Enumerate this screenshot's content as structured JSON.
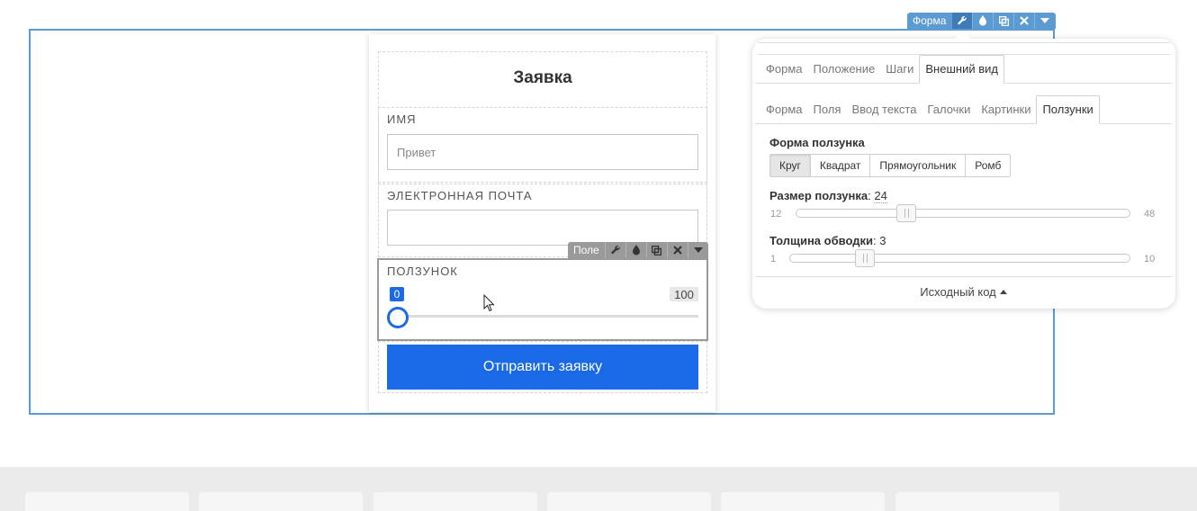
{
  "block_toolbar": {
    "label": "Форма",
    "icons": [
      "wrench-icon",
      "drop-icon",
      "copy-icon",
      "close-icon",
      "caret-down-icon"
    ]
  },
  "form": {
    "title": "Заявка",
    "fields": [
      {
        "label": "ИМЯ",
        "value": "Привет"
      },
      {
        "label": "ЭЛЕКТРОННАЯ ПОЧТА",
        "value": ""
      }
    ],
    "slider": {
      "label": "ПОЛЗУНОК",
      "min_badge": "0",
      "max_badge": "100",
      "value_fraction": 0.0
    },
    "submit_label": "Отправить заявку"
  },
  "field_toolbar": {
    "label": "Поле",
    "icons": [
      "wrench-icon",
      "drop-icon",
      "copy-icon",
      "close-icon",
      "caret-down-icon"
    ]
  },
  "settings": {
    "main_tabs": [
      "Форма",
      "Положение",
      "Шаги",
      "Внешний вид"
    ],
    "main_active": 3,
    "sub_tabs": [
      "Форма",
      "Поля",
      "Ввод текста",
      "Галочки",
      "Картинки",
      "Ползунки"
    ],
    "sub_active": 5,
    "shape": {
      "title": "Форма ползунка",
      "options": [
        "Круг",
        "Квадрат",
        "Прямоугольник",
        "Ромб"
      ],
      "active": 0
    },
    "size": {
      "title": "Размер ползунка",
      "value": "24",
      "min": "12",
      "max": "48"
    },
    "border": {
      "title": "Толщина обводки",
      "value": "3",
      "min": "1",
      "max": "10"
    },
    "source_code_label": "Исходный код"
  },
  "colors": {
    "accent": "#1a6ae8",
    "selection": "#5b9bd1"
  }
}
